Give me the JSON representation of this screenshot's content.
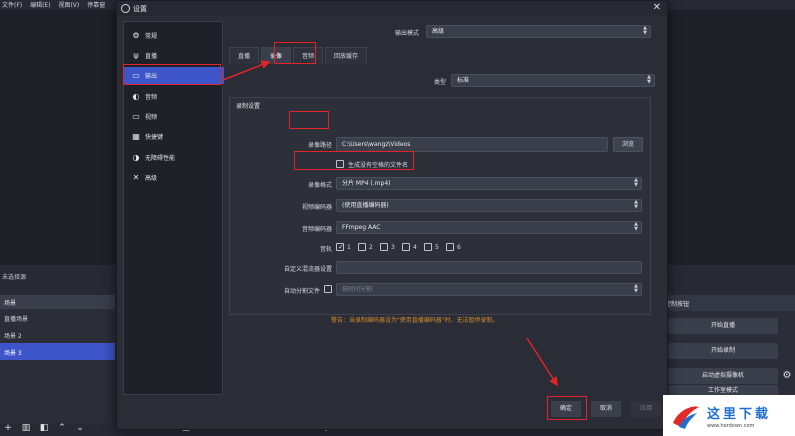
{
  "obs": {
    "menubar": [
      "文件(F)",
      "编辑(E)",
      "视图(V)",
      "停靠窗"
    ],
    "no_scene_text": "未选择源",
    "scenes_header": "场景",
    "scenes": [
      {
        "name": "直播场景",
        "active": false
      },
      {
        "name": "场景 2",
        "active": false
      },
      {
        "name": "场景 3",
        "active": true
      }
    ],
    "controls_header": "控制按钮",
    "controls": [
      "开始直播",
      "开始录制",
      "启动虚拟摄像机",
      "工作室模式"
    ]
  },
  "dialog": {
    "title": "设置",
    "close": "✕",
    "nav": [
      {
        "label": "常规",
        "icon": "gear-icon",
        "glyph": "⚙",
        "active": false
      },
      {
        "label": "直播",
        "icon": "antenna-icon",
        "glyph": "ψ",
        "active": false
      },
      {
        "label": "输出",
        "icon": "output-icon",
        "glyph": "▭",
        "active": true
      },
      {
        "label": "音频",
        "icon": "speaker-icon",
        "glyph": "◐",
        "active": false
      },
      {
        "label": "视频",
        "icon": "monitor-icon",
        "glyph": "▭",
        "active": false
      },
      {
        "label": "快捷键",
        "icon": "keyboard-icon",
        "glyph": "▦",
        "active": false
      },
      {
        "label": "无障碍性能",
        "icon": "accessibility-icon",
        "glyph": "◑",
        "active": false
      },
      {
        "label": "高级",
        "icon": "wrench-icon",
        "glyph": "✕",
        "active": false
      }
    ],
    "output_mode_label": "输出模式",
    "output_mode_value": "高级",
    "tabs": [
      {
        "label": "直播",
        "active": false
      },
      {
        "label": "录像",
        "active": true
      },
      {
        "label": "音频",
        "active": false
      },
      {
        "label": "回放缓存",
        "active": false
      }
    ],
    "type_label": "类型",
    "type_value": "标准",
    "group_title": "录制设置",
    "rec_path_label": "录像路径",
    "rec_path_value": "C:\\Users\\wangz\\Videos",
    "browse_label": "浏览",
    "no_space_label": "生成没有空格的文件名",
    "rec_format_label": "录像格式",
    "rec_format_value": "分片 MP4 (.mp4)",
    "video_encoder_label": "视频编码器",
    "video_encoder_value": "(使用直播编码器)",
    "audio_encoder_label": "音频编码器",
    "audio_encoder_value": "FFmpeg AAC",
    "tracks_label": "音轨",
    "tracks": [
      "1",
      "2",
      "3",
      "4",
      "5",
      "6"
    ],
    "custom_muxer_label": "自定义混流器设置",
    "autosplit_label": "自动分割文件",
    "autosplit_value": "按时间分割",
    "warning": "警告：当录制编码器设为\"使用直播编码器\"时，无法暂停录制。",
    "ok": "确定",
    "cancel": "取消",
    "apply": "应用"
  },
  "watermark": {
    "cn": "这里下载",
    "url": "www.herdown.com"
  },
  "colors": {
    "accent": "#3d55c8",
    "highlight": "#e0242a",
    "warning": "#d28a2d"
  }
}
